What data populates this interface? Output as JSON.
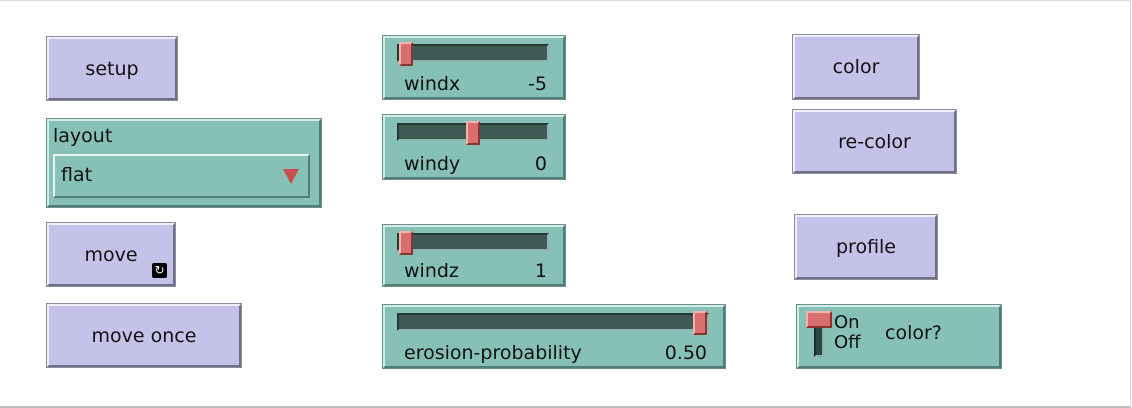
{
  "buttons": {
    "setup": "setup",
    "move": "move",
    "move_forever_icon": "↻",
    "move_once": "move once",
    "color": "color",
    "re_color": "re-color",
    "profile": "profile"
  },
  "chooser": {
    "label": "layout",
    "value": "flat"
  },
  "sliders": {
    "windx": {
      "label": "windx",
      "value": "-5",
      "fraction": 0.0
    },
    "windy": {
      "label": "windy",
      "value": "0",
      "fraction": 0.5
    },
    "windz": {
      "label": "windz",
      "value": "1",
      "fraction": 0.0
    },
    "erosion": {
      "label": "erosion-probability",
      "value": "0.50",
      "fraction": 1.0
    }
  },
  "switch": {
    "on_label": "On",
    "off_label": "Off",
    "label": "color?",
    "state": "on"
  },
  "icons": {
    "forever": "forever-loop-icon",
    "dropdown": "dropdown-arrow-icon"
  },
  "colors": {
    "button": "#c4c2e8",
    "widget": "#86c0b6",
    "handle": "#d86f6c",
    "track": "#3e5a55"
  }
}
